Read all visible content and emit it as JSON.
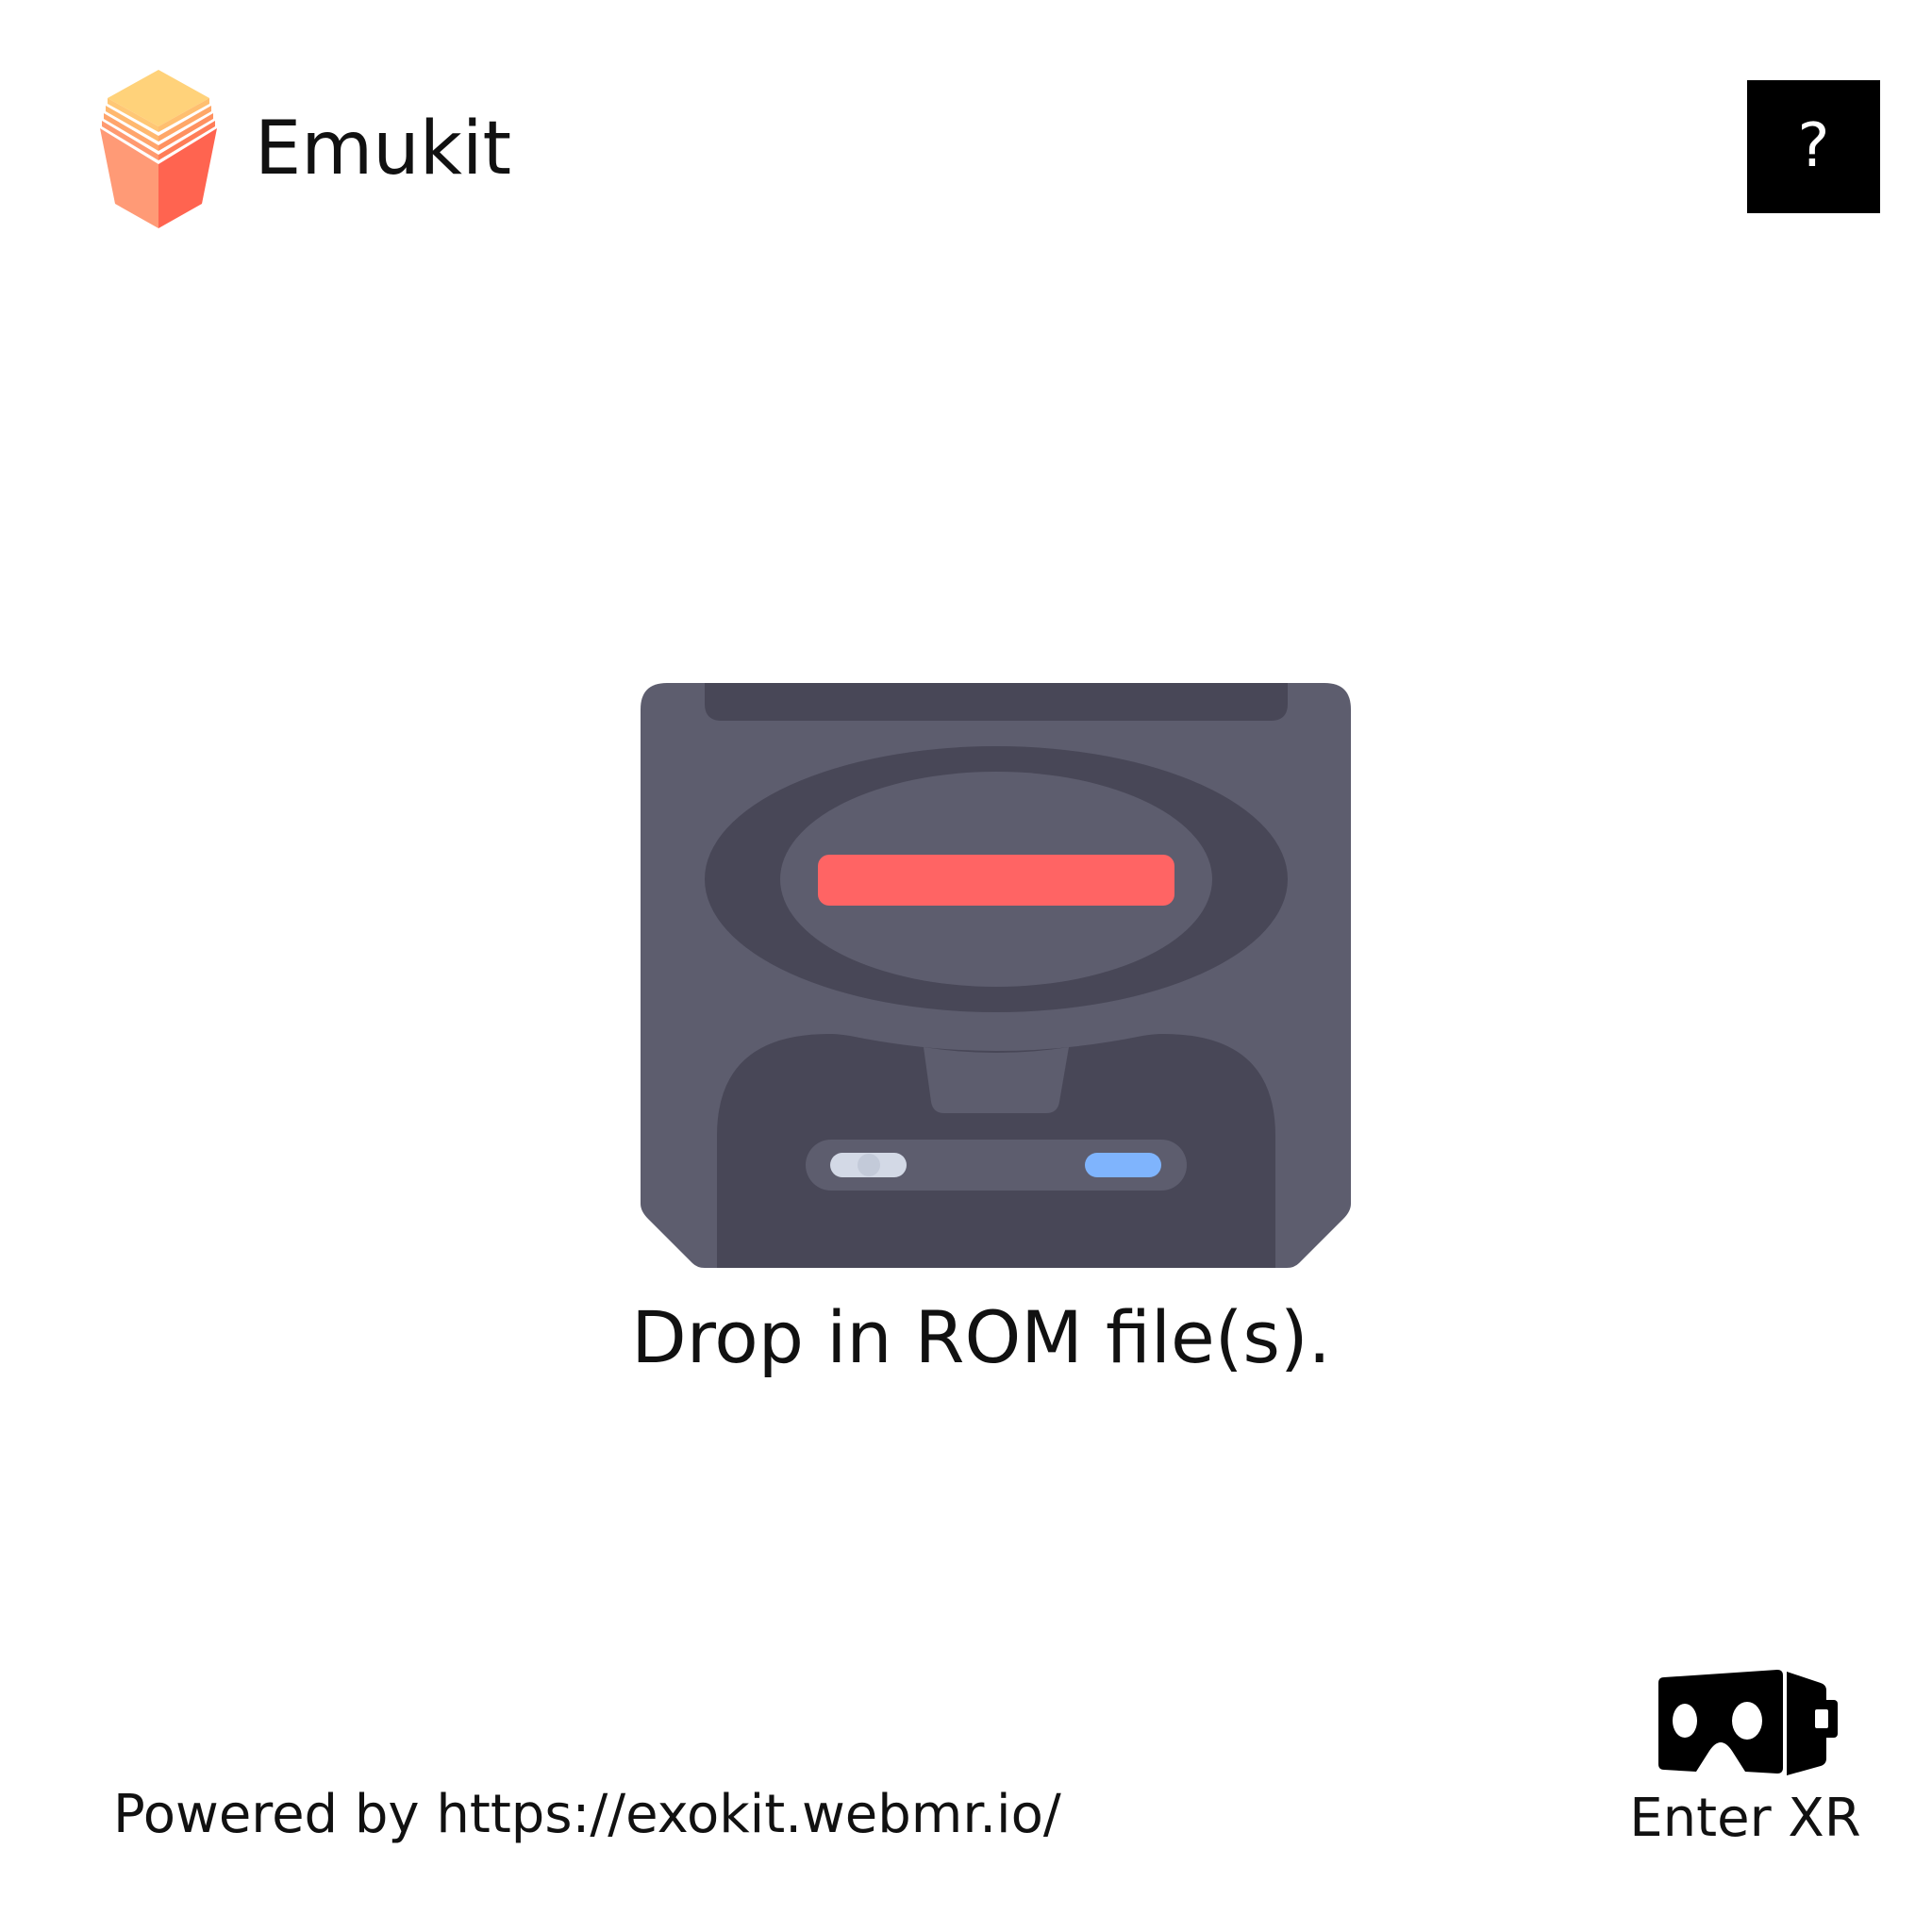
{
  "header": {
    "title": "Emukit",
    "logo_icon": "emukit-logo-icon",
    "help_label": "?"
  },
  "main": {
    "drop_prompt": "Drop in ROM file(s).",
    "console_icon": "retro-console-icon"
  },
  "footer": {
    "powered_by": "Powered by https://exokit.webmr.io/",
    "enter_xr_label": "Enter XR",
    "xr_icon": "vr-headset-icon"
  },
  "colors": {
    "background": "#ffffff",
    "text": "#111111",
    "help_button_bg": "#000000",
    "console_body": "#5d5d6e",
    "console_dark": "#484757",
    "console_red": "#ff6464",
    "console_blue": "#7fb4fd",
    "console_light": "#d3d9e6",
    "logo_top": "#ffd27a",
    "logo_left": "#ff9a76",
    "logo_right": "#ff6450"
  }
}
